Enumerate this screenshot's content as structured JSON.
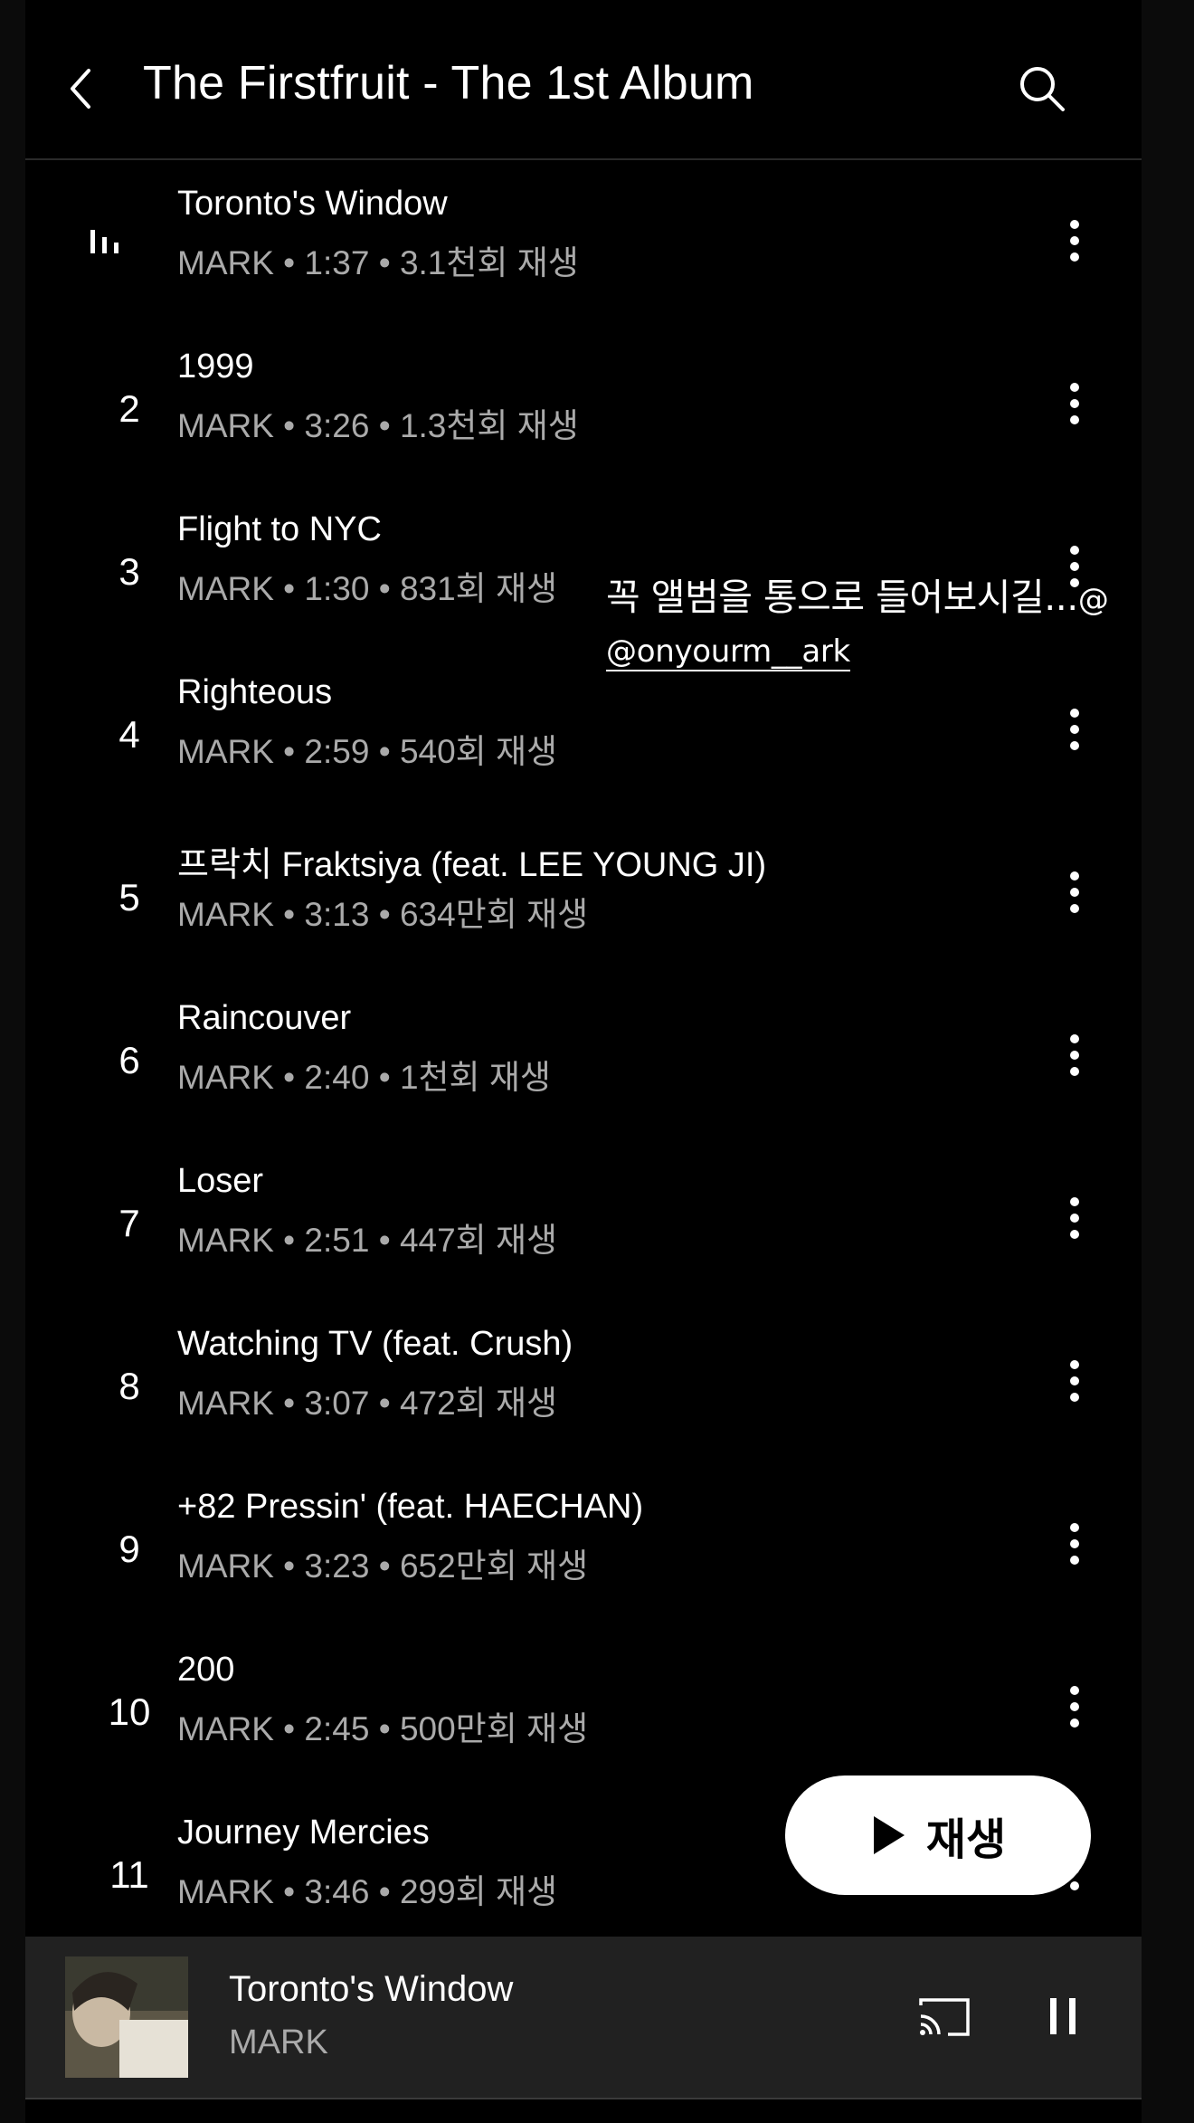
{
  "header": {
    "title": "The Firstfruit - The 1st Album"
  },
  "tracks": [
    {
      "number": "",
      "title": "Toronto's Window",
      "meta": "MARK • 1:37 • 3.1천회 재생",
      "playing": true
    },
    {
      "number": "2",
      "title": "1999",
      "meta": "MARK • 3:26 • 1.3천회 재생"
    },
    {
      "number": "3",
      "title": "Flight to NYC",
      "meta": "MARK • 1:30 • 831회 재생"
    },
    {
      "number": "4",
      "title": "Righteous",
      "meta": "MARK • 2:59 • 540회 재생"
    },
    {
      "number": "5",
      "title": "프락치 Fraktsiya (feat. LEE YOUNG JI)",
      "meta": "MARK • 3:13 • 634만회 재생"
    },
    {
      "number": "6",
      "title": "Raincouver",
      "meta": "MARK • 2:40 • 1천회 재생"
    },
    {
      "number": "7",
      "title": "Loser",
      "meta": "MARK • 2:51 • 447회 재생"
    },
    {
      "number": "8",
      "title": "Watching TV (feat. Crush)",
      "meta": "MARK • 3:07 • 472회 재생"
    },
    {
      "number": "9",
      "title": "+82 Pressin' (feat. HAECHAN)",
      "meta": "MARK • 3:23 • 652만회 재생"
    },
    {
      "number": "10",
      "title": "200",
      "meta": "MARK • 2:45 • 500만회 재생"
    },
    {
      "number": "11",
      "title": "Journey Mercies",
      "meta": "MARK • 3:46 • 299회 재생"
    }
  ],
  "overlay": {
    "text": "꼭 앨범을 통으로 들어보시길...",
    "emoji_glyph": "@",
    "handle": "@onyourm__ark"
  },
  "play_button": {
    "label": "재생"
  },
  "mini_player": {
    "title": "Toronto's Window",
    "artist": "MARK"
  },
  "icons": {
    "back": "chevron-left-icon",
    "search": "search-icon",
    "more": "more-vertical-icon",
    "now_playing": "equalizer-icon",
    "play": "play-icon",
    "cast": "cast-icon",
    "pause": "pause-icon"
  },
  "colors": {
    "background": "#000000",
    "secondary_text": "#aaaaaa",
    "mini_player_bg": "#212121",
    "button_bg": "#ffffff"
  }
}
